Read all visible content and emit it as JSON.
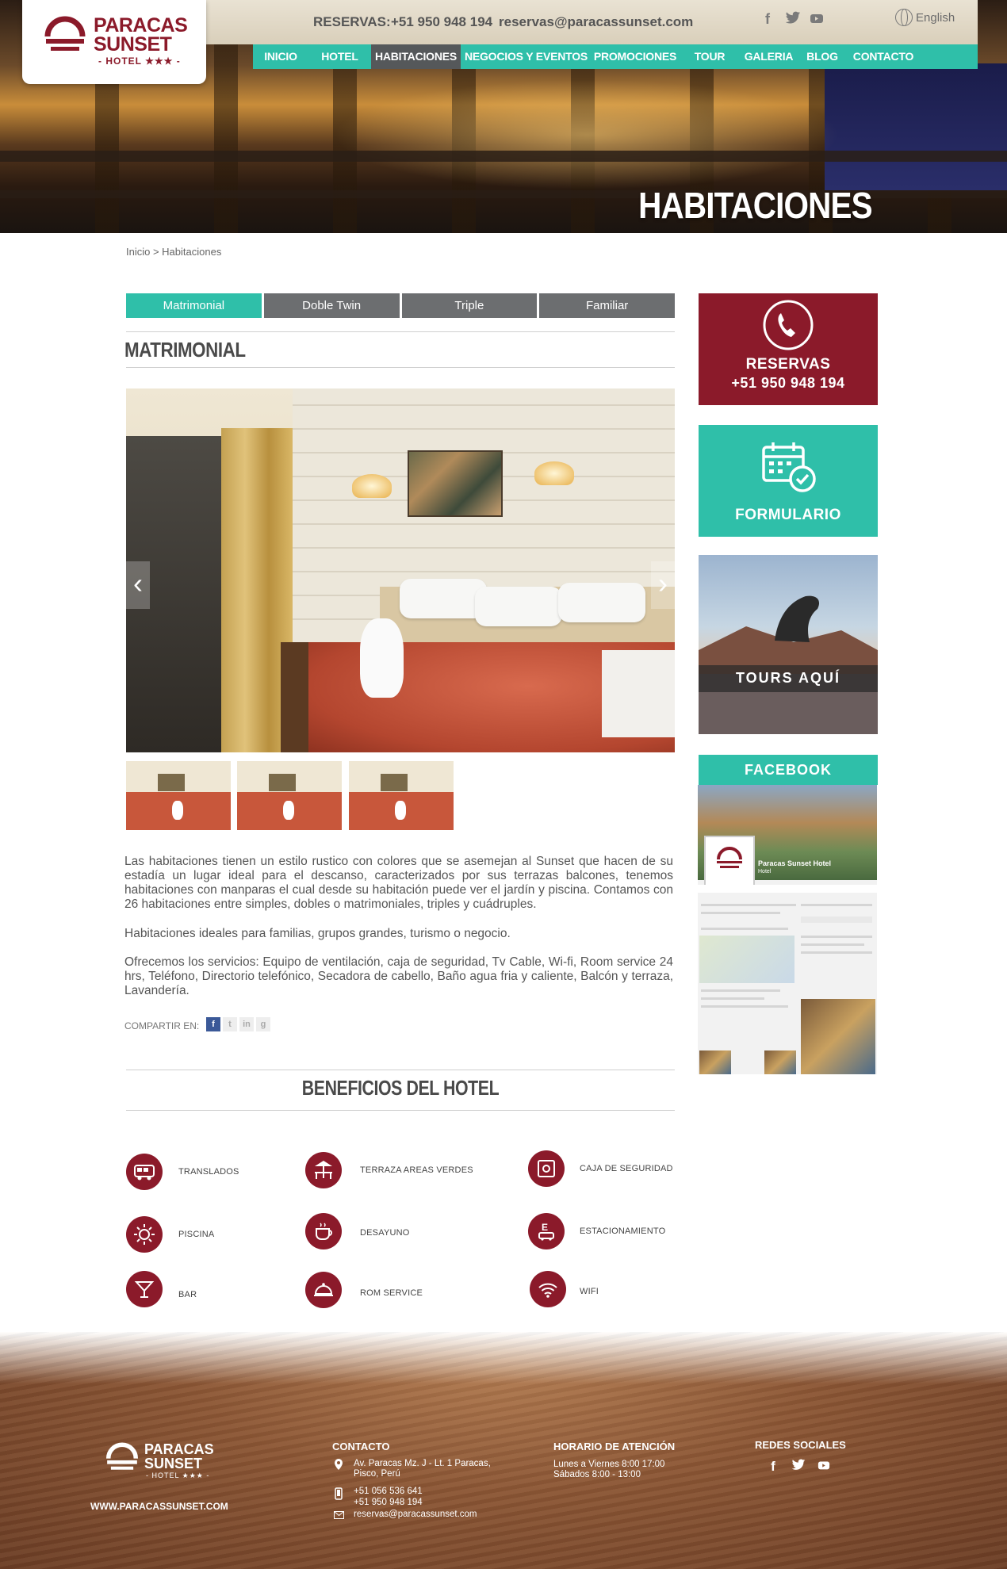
{
  "header": {
    "logo": {
      "line1": "PARACAS",
      "line2": "SUNSET",
      "line3": "- HOTEL ★★★ -"
    },
    "reservas_label": "RESERVAS:",
    "reservas_phone": "+51 950 948 194",
    "reservas_email": "reservas@paracassunset.com",
    "social_icons": [
      "facebook-icon",
      "twitter-icon",
      "youtube-icon"
    ],
    "language": "English",
    "nav": [
      "INICIO",
      "HOTEL",
      "HABITACIONES",
      "NEGOCIOS Y EVENTOS",
      "PROMOCIONES",
      "TOUR",
      "GALERIA",
      "BLOG",
      "CONTACTO"
    ],
    "nav_active": "HABITACIONES"
  },
  "hero": {
    "title": "HABITACIONES"
  },
  "breadcrumb": "Inicio > Habitaciones",
  "tabs": [
    "Matrimonial",
    "Doble Twin",
    "Triple",
    "Familiar"
  ],
  "tab_active": "Matrimonial",
  "room": {
    "title": "MATRIMONIAL",
    "description": [
      "Las habitaciones tienen un estilo rustico con colores que se asemejan al Sunset que hacen de su estadía un lugar ideal para el descanso, caracterizados por sus terrazas balcones, tenemos habitaciones con manparas el cual desde su habitación puede ver el jardín y piscina. Contamos con 26 habitaciones entre simples, dobles o matrimoniales, triples y cuádruples.",
      "Habitaciones ideales para familias, grupos grandes, turismo o negocio.",
      "Ofrecemos los servicios: Equipo de ventilación, caja de seguridad, Tv Cable, Wi-fi, Room service 24 hrs, Teléfono, Directorio telefónico, Secadora de cabello, Baño agua fria y caliente, Balcón y terraza, Lavandería."
    ],
    "share_label": "COMPARTIR EN:",
    "share_icons": [
      "facebook-icon",
      "twitter-icon",
      "linkedin-icon",
      "googleplus-icon"
    ]
  },
  "benefits": {
    "title": "BENEFICIOS DEL HOTEL",
    "items": [
      {
        "label": "TRANSLADOS",
        "icon": "van-icon"
      },
      {
        "label": "TERRAZA AREAS VERDES",
        "icon": "terrace-icon"
      },
      {
        "label": "CAJA DE SEGURIDAD",
        "icon": "safe-icon"
      },
      {
        "label": "PISCINA",
        "icon": "sun-icon"
      },
      {
        "label": "DESAYUNO",
        "icon": "coffee-icon"
      },
      {
        "label": "ESTACIONAMIENTO",
        "icon": "parking-icon"
      },
      {
        "label": "BAR",
        "icon": "cocktail-icon"
      },
      {
        "label": "ROM SERVICE",
        "icon": "cloche-icon"
      },
      {
        "label": "WIFI",
        "icon": "wifi-icon"
      }
    ]
  },
  "sidebar": {
    "reservas": {
      "title": "RESERVAS",
      "phone": "+51 950 948 194",
      "icon": "phone-icon"
    },
    "formulario": {
      "title": "FORMULARIO",
      "icon": "calendar-check-icon"
    },
    "tours": {
      "title": "TOURS AQUÍ"
    },
    "facebook": {
      "title": "FACEBOOK",
      "page_name": "Paracas Sunset Hotel",
      "page_type": "Hotel"
    }
  },
  "footer": {
    "logo": {
      "line1": "PARACAS",
      "line2": "SUNSET",
      "line3": "- HOTEL ★★★ -"
    },
    "website": "WWW.PARACASSUNSET.COM",
    "contacto": {
      "title": "CONTACTO",
      "address": [
        "Av. Paracas Mz. J - Lt. 1 Paracas,",
        "Pisco, Perú"
      ],
      "phones": [
        "+51 056 536 641",
        "+51 950 948 194"
      ],
      "email": "reservas@paracassunset.com"
    },
    "horario": {
      "title": "HORARIO DE ATENCIÓN",
      "lines": [
        "Lunes a Viernes 8:00 17:00",
        "Sábados 8:00 - 13:00"
      ]
    },
    "redes": {
      "title": "REDES SOCIALES",
      "icons": [
        "facebook-icon",
        "twitter-icon",
        "youtube-icon"
      ]
    }
  },
  "colors": {
    "teal": "#2fbfa9",
    "wine": "#8b1a2a",
    "grey_tab": "#6c6e70",
    "nav_active": "#55585a"
  }
}
